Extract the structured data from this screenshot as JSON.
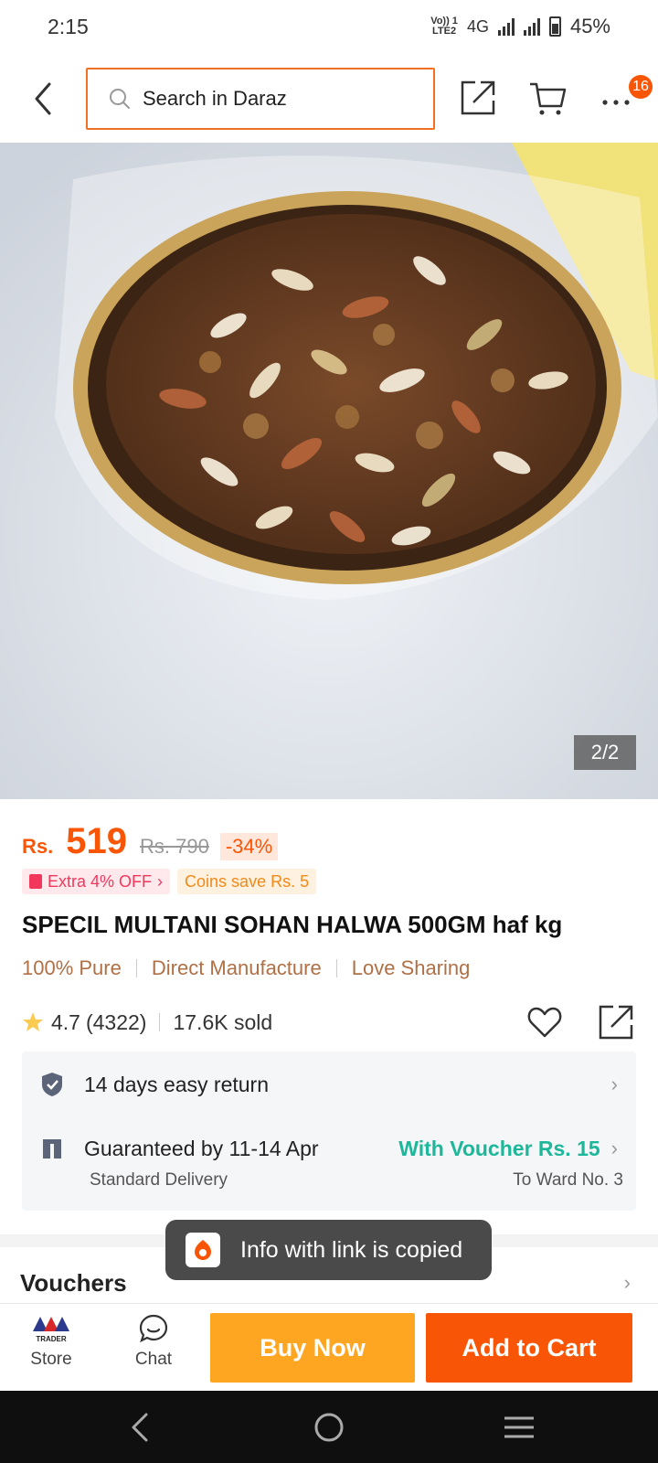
{
  "status_bar": {
    "time": "2:15",
    "network_label_top": "Vo)) 1",
    "network_label_bottom": "LTE2",
    "network_type": "4G",
    "battery": "45%"
  },
  "top_nav": {
    "search_placeholder": "Search in Daraz",
    "cart_badge": "16",
    "icons": [
      "back-arrow-icon",
      "search-icon",
      "share-icon",
      "cart-icon",
      "more-icon"
    ]
  },
  "gallery": {
    "counter": "2/2"
  },
  "price": {
    "currency": "Rs.",
    "current": "519",
    "original": "Rs. 790",
    "discount": "-34%"
  },
  "promos": {
    "extra_off": "Extra 4% OFF",
    "coins": "Coins save Rs. 5"
  },
  "product": {
    "title": "SPECIL MULTANI SOHAN HALWA 500GM haf kg",
    "highlights": [
      "100% Pure",
      "Direct Manufacture",
      "Love Sharing"
    ],
    "rating": "4.7",
    "rating_count": "(4322)",
    "sold": "17.6K sold"
  },
  "services": {
    "return": "14 days easy return",
    "delivery_guarantee": "Guaranteed by 11-14 Apr",
    "delivery_type": "Standard Delivery",
    "voucher": "With Voucher Rs. 15",
    "destination": "To Ward No. 3"
  },
  "sections": {
    "vouchers": "Vouchers"
  },
  "toast": {
    "message": "Info with link is copied"
  },
  "bottom_bar": {
    "store_logo_text": "TRADER",
    "store": "Store",
    "chat": "Chat",
    "buy_now": "Buy Now",
    "add_to_cart": "Add to Cart"
  },
  "colors": {
    "brand_orange": "#f85606",
    "buy_now_yellow": "#fea622",
    "voucher_green": "#1db79a",
    "highlight_brown": "#b07045"
  }
}
